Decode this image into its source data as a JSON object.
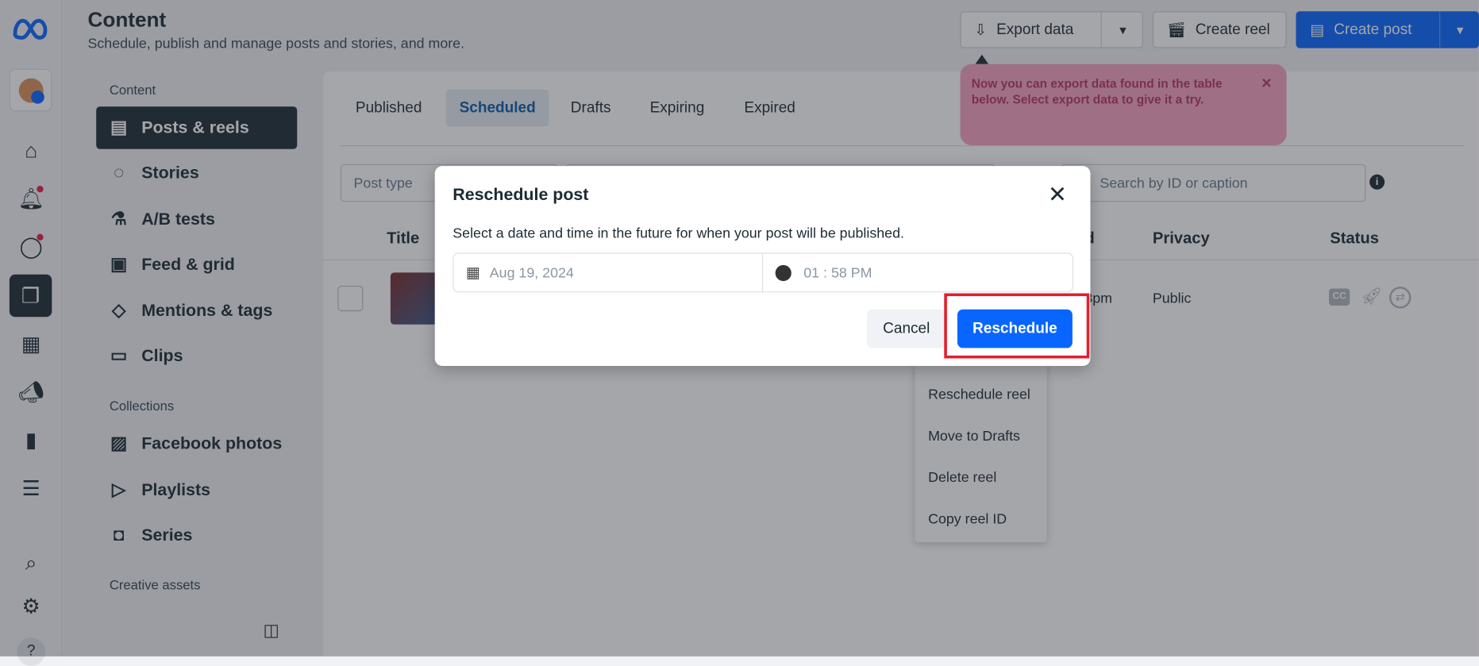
{
  "header": {
    "title": "Content",
    "subtitle": "Schedule, publish and manage posts and stories, and more."
  },
  "actions": {
    "export": "Export data",
    "create_reel": "Create reel",
    "create_post": "Create post"
  },
  "tooltip": {
    "text": "Now you can export data found in the table below. Select export data to give it a try.",
    "close": "×"
  },
  "sidebar": {
    "sections": [
      "Content",
      "Collections",
      "Creative assets"
    ],
    "items": [
      {
        "label": "Posts & reels",
        "icon": "posts-icon"
      },
      {
        "label": "Stories",
        "icon": "stories-icon"
      },
      {
        "label": "A/B tests",
        "icon": "flask-icon"
      },
      {
        "label": "Feed & grid",
        "icon": "grid-icon"
      },
      {
        "label": "Mentions & tags",
        "icon": "tag-icon"
      },
      {
        "label": "Clips",
        "icon": "clapper-icon"
      },
      {
        "label": "Facebook photos",
        "icon": "photo-icon"
      },
      {
        "label": "Playlists",
        "icon": "playlist-icon"
      },
      {
        "label": "Series",
        "icon": "series-icon"
      }
    ]
  },
  "tabs": [
    "Published",
    "Scheduled",
    "Drafts",
    "Expiring",
    "Expired"
  ],
  "filters": {
    "post_type": "Post type",
    "search_placeholder": "Search by ID or caption"
  },
  "table": {
    "headers": [
      "Title",
      "d",
      "Privacy",
      "Status"
    ],
    "row": {
      "time": "3pm",
      "privacy": "Public"
    }
  },
  "context_menu": [
    "Reschedule reel",
    "Move to Drafts",
    "Delete reel",
    "Copy reel ID"
  ],
  "modal": {
    "title": "Reschedule post",
    "description": "Select a date and time in the future for when your post will be published.",
    "date": "Aug 19, 2024",
    "time": "01 : 58 PM",
    "cancel": "Cancel",
    "confirm": "Reschedule"
  },
  "colors": {
    "accent": "#0866ff",
    "highlight": "#e41e2b",
    "nav_selected": "#1c2b33"
  }
}
